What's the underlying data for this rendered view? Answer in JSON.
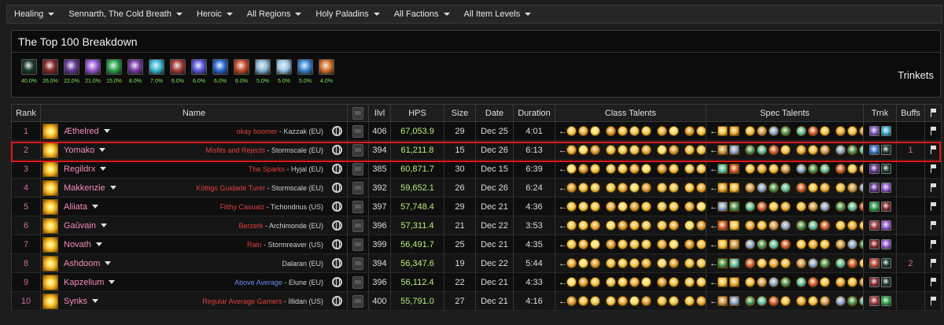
{
  "filters": [
    {
      "label": "Healing"
    },
    {
      "label": "Sennarth, The Cold Breath"
    },
    {
      "label": "Heroic"
    },
    {
      "label": "All Regions"
    },
    {
      "label": "Holy Paladins"
    },
    {
      "label": "All Factions"
    },
    {
      "label": "All Item Levels"
    }
  ],
  "breakdown": {
    "title": "The Top 100 Breakdown",
    "mode": "Trinkets",
    "trinkets": [
      {
        "pct": "40.0%",
        "icon": "trinket-eye-icon",
        "color": "#1b3a2a"
      },
      {
        "pct": "26.0%",
        "icon": "trinket-blood-rune-icon",
        "color": "#8a2a2a"
      },
      {
        "pct": "22.0%",
        "icon": "trinket-purple-orb-icon",
        "color": "#6a3a9a"
      },
      {
        "pct": "21.0%",
        "icon": "trinket-violet-gem-icon",
        "color": "#9a5ad8"
      },
      {
        "pct": "15.0%",
        "icon": "trinket-green-crystal-icon",
        "color": "#2aa84a"
      },
      {
        "pct": "8.0%",
        "icon": "trinket-arcane-icon",
        "color": "#7a3aa8"
      },
      {
        "pct": "7.0%",
        "icon": "trinket-frost-orb-icon",
        "color": "#3ab8d8"
      },
      {
        "pct": "6.0%",
        "icon": "trinket-red-sigil-icon",
        "color": "#a83a3a"
      },
      {
        "pct": "6.0%",
        "icon": "trinket-blue-violet-icon",
        "color": "#5a5ae0"
      },
      {
        "pct": "6.0%",
        "icon": "trinket-blue-swirl-icon",
        "color": "#2a6ad8"
      },
      {
        "pct": "6.0%",
        "icon": "trinket-red-feather-icon",
        "color": "#c84a2a"
      },
      {
        "pct": "5.0%",
        "icon": "trinket-ice-shard-icon",
        "color": "#8ab8d8"
      },
      {
        "pct": "5.0%",
        "icon": "trinket-pale-blue-icon",
        "color": "#9ac8e8"
      },
      {
        "pct": "5.0%",
        "icon": "trinket-blue-rune-icon",
        "color": "#3a8ad8"
      },
      {
        "pct": "4.0%",
        "icon": "trinket-fire-orb-icon",
        "color": "#d8702a"
      }
    ]
  },
  "table": {
    "headers": {
      "rank": "Rank",
      "name": "Name",
      "ilvl": "Ilvl",
      "hps": "HPS",
      "size": "Size",
      "date": "Date",
      "duration": "Duration",
      "class_talents": "Class Talents",
      "spec_talents": "Spec Talents",
      "trnk": "Trnk",
      "buffs": "Buffs"
    },
    "rows": [
      {
        "rank": "1",
        "name": "Æthelred",
        "guild": "okay boomer",
        "server": " - Kazzak (EU)",
        "guild_color": "#e04040",
        "ilvl": "406",
        "hps": "67,053.9",
        "size": "29",
        "date": "Dec 25",
        "duration": "4:01",
        "buffs": "",
        "trinkets": [
          "#8a5ad0",
          "#3ab8d8"
        ],
        "highlighted": false
      },
      {
        "rank": "2",
        "name": "Yomako",
        "guild": "Misfits and Rejects",
        "server": " - Stormscale (EU)",
        "guild_color": "#e04040",
        "ilvl": "394",
        "hps": "61,211.8",
        "size": "15",
        "date": "Dec 26",
        "duration": "6:13",
        "buffs": "1",
        "trinkets": [
          "#3a7ad8",
          "#1b3a2a"
        ],
        "highlighted": true
      },
      {
        "rank": "3",
        "name": "Regildrx",
        "guild": "The Sparks",
        "server": " - Hyjal (EU)",
        "guild_color": "#e04040",
        "ilvl": "385",
        "hps": "60,871.7",
        "size": "30",
        "date": "Dec 15",
        "duration": "6:39",
        "buffs": "",
        "trinkets": [
          "#6a3a9a",
          "#1b3a2a"
        ],
        "highlighted": false
      },
      {
        "rank": "4",
        "name": "Makkenzie",
        "guild": "Köttigs Guidade Turer",
        "server": " - Stormscale (EU)",
        "guild_color": "#e04040",
        "ilvl": "392",
        "hps": "59,652.1",
        "size": "26",
        "date": "Dec 26",
        "duration": "6:24",
        "buffs": "",
        "trinkets": [
          "#6a3a9a",
          "#9a5ad8"
        ],
        "highlighted": false
      },
      {
        "rank": "5",
        "name": "Aliiata",
        "guild": "Filthy Casualz",
        "server": " - Tichondrius (US)",
        "guild_color": "#e04040",
        "ilvl": "397",
        "hps": "57,748.4",
        "size": "29",
        "date": "Dec 21",
        "duration": "4:36",
        "buffs": "",
        "trinkets": [
          "#2aa84a",
          "#8a2a2a"
        ],
        "highlighted": false
      },
      {
        "rank": "6",
        "name": "Gaûvain",
        "guild": "Berzerk",
        "server": " - Archimonde (EU)",
        "guild_color": "#e04040",
        "ilvl": "396",
        "hps": "57,311.4",
        "size": "21",
        "date": "Dec 22",
        "duration": "3:53",
        "buffs": "",
        "trinkets": [
          "#a83a3a",
          "#9a5ad8"
        ],
        "highlighted": false
      },
      {
        "rank": "7",
        "name": "Novath",
        "guild": "Rain",
        "server": " - Stormreaver (US)",
        "guild_color": "#e04040",
        "ilvl": "399",
        "hps": "56,491.7",
        "size": "25",
        "date": "Dec 21",
        "duration": "4:35",
        "buffs": "",
        "trinkets": [
          "#8a2a2a",
          "#9a5ad8"
        ],
        "highlighted": false
      },
      {
        "rank": "8",
        "name": "Ashdoom",
        "guild": "",
        "server": "Dalaran (EU)",
        "guild_color": "#e04040",
        "ilvl": "394",
        "hps": "56,347.6",
        "size": "19",
        "date": "Dec 22",
        "duration": "5:44",
        "buffs": "2",
        "trinkets": [
          "#c84a2a",
          "#1b3a2a"
        ],
        "highlighted": false
      },
      {
        "rank": "9",
        "name": "Kapzelium",
        "guild": "Above Average",
        "server": " - Elune (EU)",
        "guild_color": "#6a8ae8",
        "ilvl": "396",
        "hps": "56,112.4",
        "size": "22",
        "date": "Dec 21",
        "duration": "4:33",
        "buffs": "",
        "trinkets": [
          "#8a2a2a",
          "#1b3a2a"
        ],
        "highlighted": false
      },
      {
        "rank": "10",
        "name": "Synks",
        "guild": "Regular Average Gamers",
        "server": " - Illidan (US)",
        "guild_color": "#e04040",
        "ilvl": "400",
        "hps": "55,791.0",
        "size": "27",
        "date": "Dec 21",
        "duration": "4:16",
        "buffs": "",
        "trinkets": [
          "#a83a3a",
          "#2aa84a"
        ],
        "highlighted": false
      }
    ]
  },
  "colors": {
    "paladin_pink": "#f48cba",
    "hps_green": "#b8ee78",
    "trinket_pct_green": "#7fe25a",
    "highlight_red": "#e01818"
  }
}
